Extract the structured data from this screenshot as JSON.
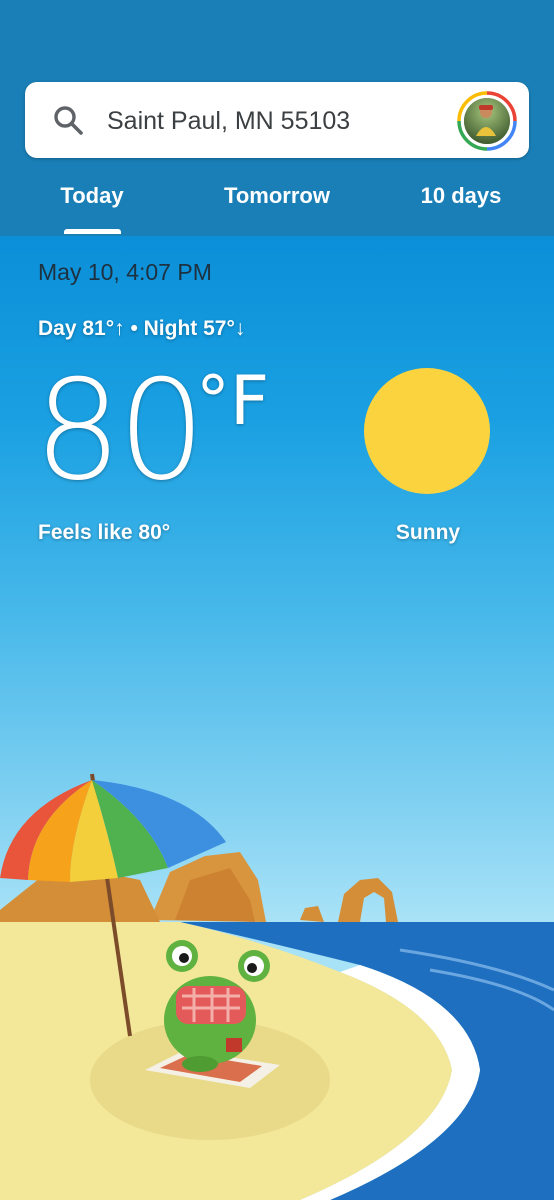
{
  "search": {
    "location": "Saint Paul, MN 55103",
    "icon": "search-icon",
    "avatar_ring_colors": [
      "#ea4335",
      "#fbbc05",
      "#34a853",
      "#4285f4"
    ]
  },
  "tabs": [
    {
      "label": "Today",
      "selected": true
    },
    {
      "label": "Tomorrow",
      "selected": false
    },
    {
      "label": "10 days",
      "selected": false
    }
  ],
  "weather": {
    "datetime": "May 10, 4:07 PM",
    "day_night": "Day 81°↑ • Night 57°↓",
    "temperature": "80",
    "unit": "°F",
    "feels_like": "Feels like 80°",
    "condition": "Sunny",
    "condition_icon": "sun-icon",
    "sun_color": "#fbd33f"
  },
  "colors": {
    "header_bg": "#1a7fb6",
    "sky_top": "#0b8fd8",
    "sea": "#1f6fc1",
    "sand": "#f3e79a"
  }
}
